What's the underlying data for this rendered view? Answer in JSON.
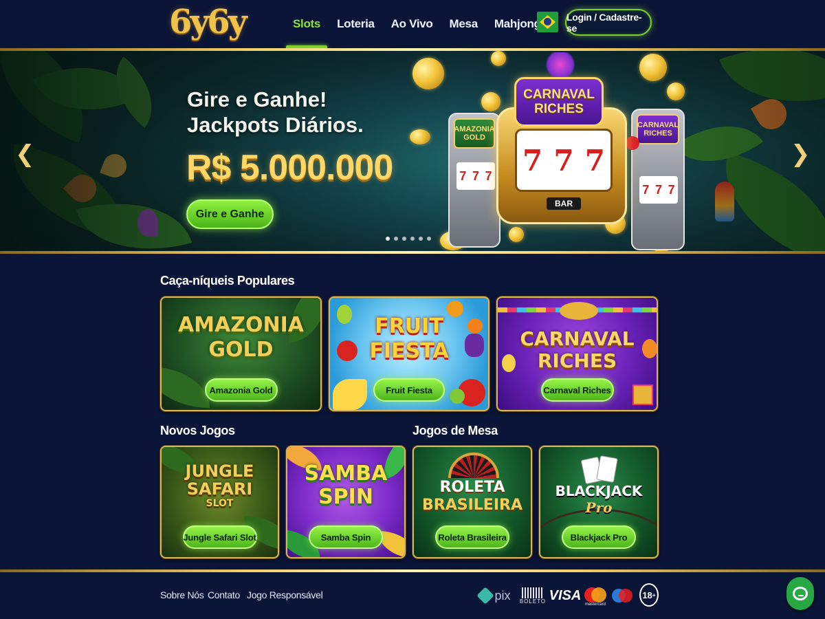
{
  "header": {
    "logo": "6y6y",
    "nav": [
      {
        "label": "Slots",
        "active": true
      },
      {
        "label": "Loteria",
        "active": false
      },
      {
        "label": "Ao Vivo",
        "active": false
      },
      {
        "label": "Mesa",
        "active": false
      },
      {
        "label": "Mahjong",
        "active": false
      }
    ],
    "flag_icon": "brazil-flag-icon",
    "login_label": "Login / Cadastre-se"
  },
  "hero": {
    "title_line1": "Gire e Ganhe!",
    "title_line2": "Jackpots Diários.",
    "amount": "R$ 5.000.000",
    "cta_label": "Gire e Ganhe",
    "prev_icon": "chevron-left-icon",
    "next_icon": "chevron-right-icon",
    "slide_count": 6,
    "active_slide": 1,
    "machine_sign_line1": "CARNAVAL",
    "machine_sign_line2": "RICHES",
    "left_machine_line1": "AMAZONIA",
    "left_machine_line2": "GOLD",
    "right_machine_line1": "CARNAVAL",
    "right_machine_line2": "RICHES",
    "reel_symbol": "7",
    "bar_label": "BAR"
  },
  "popular": {
    "title": "Caça-níqueis Populares",
    "games": [
      {
        "art_line1": "AMAZONIA",
        "art_line2": "GOLD",
        "button": "Amazonia Gold"
      },
      {
        "art_line1": "FRUIT",
        "art_line2": "FIESTA",
        "button": "Fruit Fiesta"
      },
      {
        "art_line1": "CARNAVAL",
        "art_line2": "RICHES",
        "button": "Carnaval Riches"
      }
    ]
  },
  "new_games": {
    "title": "Novos Jogos",
    "games": [
      {
        "art_line1": "JUNGLE",
        "art_line2": "SAFARI",
        "art_line3": "SLOT",
        "button": "Jungle Safari Slot"
      },
      {
        "art_line1": "SAMBA",
        "art_line2": "SPIN",
        "button": "Samba Spin"
      }
    ]
  },
  "table_games": {
    "title": "Jogos de Mesa",
    "games": [
      {
        "art_line1": "ROLETA",
        "art_line2": "BRASILEIRA",
        "button": "Roleta Brasileira"
      },
      {
        "art_line1": "BLACKJACK",
        "art_line2": "Pro",
        "button": "Blackjack Pro"
      }
    ]
  },
  "footer": {
    "links": [
      "Sobre Nós",
      "Contato",
      "Jogo Responsável"
    ],
    "payments": {
      "pix": "pix",
      "boleto": "BOLETO",
      "visa": "VISA",
      "mastercard": "mastercard",
      "age": "18"
    }
  },
  "colors": {
    "background": "#0b1538",
    "accent_green": "#7fd22e",
    "gold": "#f0c24a"
  },
  "chat_icon": "chat-bubble-icon"
}
